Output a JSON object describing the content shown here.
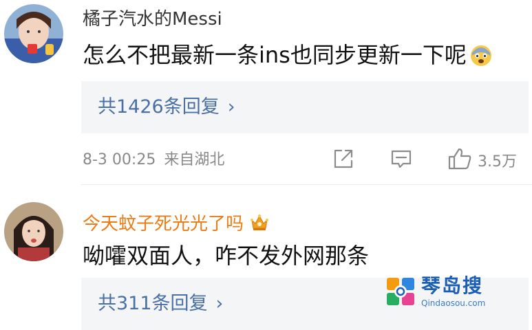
{
  "comments": [
    {
      "username": "橘子汽水的Messi",
      "text": "怎么不把最新一条ins也同步更新一下呢",
      "emoji": "fearful-face-emoji",
      "replies_label": "共1426条回复",
      "time": "8-3 00:25",
      "location": "来自湖北",
      "likes": "3.5万"
    },
    {
      "username": "今天蚊子死光光了吗",
      "badge": "crown-icon",
      "text": "呦嚯双面人，咋不发外网那条",
      "replies_label": "共311条回复"
    }
  ],
  "ui": {
    "chevron": "›"
  },
  "watermark": {
    "title": "琴岛搜",
    "url": "Qindaosou.com"
  },
  "colors": {
    "link": "#4a6fa5",
    "meta": "#888888",
    "highlight_username": "#ee7a12",
    "reply_bg": "#f4f5f7",
    "watermark": "#1b5fb5"
  }
}
